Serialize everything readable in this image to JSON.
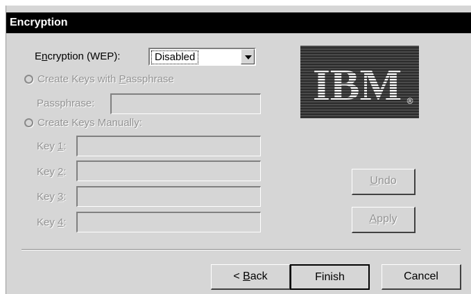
{
  "window": {
    "title": "Encryption"
  },
  "encryption": {
    "label_before": "E",
    "label_mnemonic": "n",
    "label_after": "cryption (WEP):",
    "selected": "Disabled"
  },
  "logo": {
    "text": "IBM",
    "mark": "®"
  },
  "passphrase_option": {
    "label_before": "Create Keys with ",
    "label_mnemonic": "P",
    "label_after": "assphrase"
  },
  "passphrase": {
    "label": "Passphrase:",
    "value": ""
  },
  "manual_option": {
    "label": "Create Keys Manually:"
  },
  "keys": [
    {
      "label_before": "Key ",
      "mnemonic": "1",
      "label_after": ":",
      "value": ""
    },
    {
      "label_before": "Key ",
      "mnemonic": "2",
      "label_after": ":",
      "value": ""
    },
    {
      "label_before": "Key ",
      "mnemonic": "3",
      "label_after": ":",
      "value": ""
    },
    {
      "label_before": "Key ",
      "mnemonic": "4",
      "label_after": ":",
      "value": ""
    }
  ],
  "buttons": {
    "undo": {
      "mnemonic": "U",
      "rest": "ndo"
    },
    "apply": {
      "mnemonic": "A",
      "rest": "pply"
    },
    "back": {
      "prefix": "< ",
      "mnemonic": "B",
      "rest": "ack"
    },
    "finish": "Finish",
    "cancel": "Cancel"
  }
}
